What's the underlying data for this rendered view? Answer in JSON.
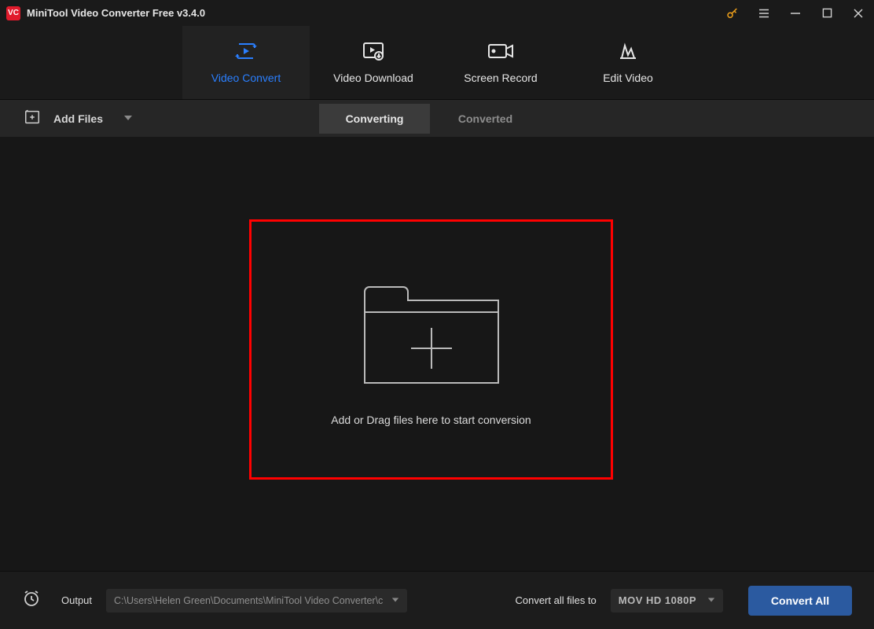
{
  "title": "MiniTool Video Converter Free v3.4.0",
  "nav": {
    "items": [
      {
        "label": "Video Convert",
        "icon": "convert-icon",
        "active": true
      },
      {
        "label": "Video Download",
        "icon": "download-icon",
        "active": false
      },
      {
        "label": "Screen Record",
        "icon": "record-icon",
        "active": false
      },
      {
        "label": "Edit Video",
        "icon": "edit-icon",
        "active": false
      }
    ]
  },
  "toolbar": {
    "add_files_label": "Add Files",
    "tabs": [
      {
        "label": "Converting",
        "active": true
      },
      {
        "label": "Converted",
        "active": false
      }
    ]
  },
  "dropzone": {
    "text": "Add or Drag files here to start conversion"
  },
  "footer": {
    "output_label": "Output",
    "output_path": "C:\\Users\\Helen Green\\Documents\\MiniTool Video Converter\\c",
    "convert_to_label": "Convert all files to",
    "format": "MOV HD 1080P",
    "convert_all_label": "Convert All"
  }
}
